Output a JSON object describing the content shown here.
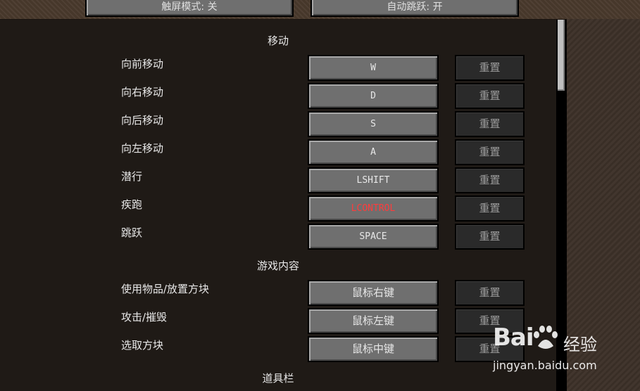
{
  "top_buttons": {
    "touchscreen": "触屏模式: 关",
    "auto_jump": "自动跳跃: 开"
  },
  "categories": {
    "movement": "移动",
    "gameplay": "游戏内容",
    "hotbar": "道具栏"
  },
  "reset_label": "重置",
  "bindings": [
    {
      "label": "向前移动",
      "key": "W"
    },
    {
      "label": "向右移动",
      "key": "D"
    },
    {
      "label": "向后移动",
      "key": "S"
    },
    {
      "label": "向左移动",
      "key": "A"
    },
    {
      "label": "潜行",
      "key": "LSHIFT"
    },
    {
      "label": "疾跑",
      "key": "LCONTROL",
      "conflict": true
    },
    {
      "label": "跳跃",
      "key": "SPACE"
    },
    {
      "label": "使用物品/放置方块",
      "key": "鼠标右键"
    },
    {
      "label": "攻击/摧毁",
      "key": "鼠标左键"
    },
    {
      "label": "选取方块",
      "key": "鼠标中键"
    }
  ],
  "watermark": {
    "logo": "Bai",
    "brand_suffix": "经验",
    "url": "jingyan.baidu.com"
  },
  "colors": {
    "conflict_key": "#ff3b3b"
  }
}
